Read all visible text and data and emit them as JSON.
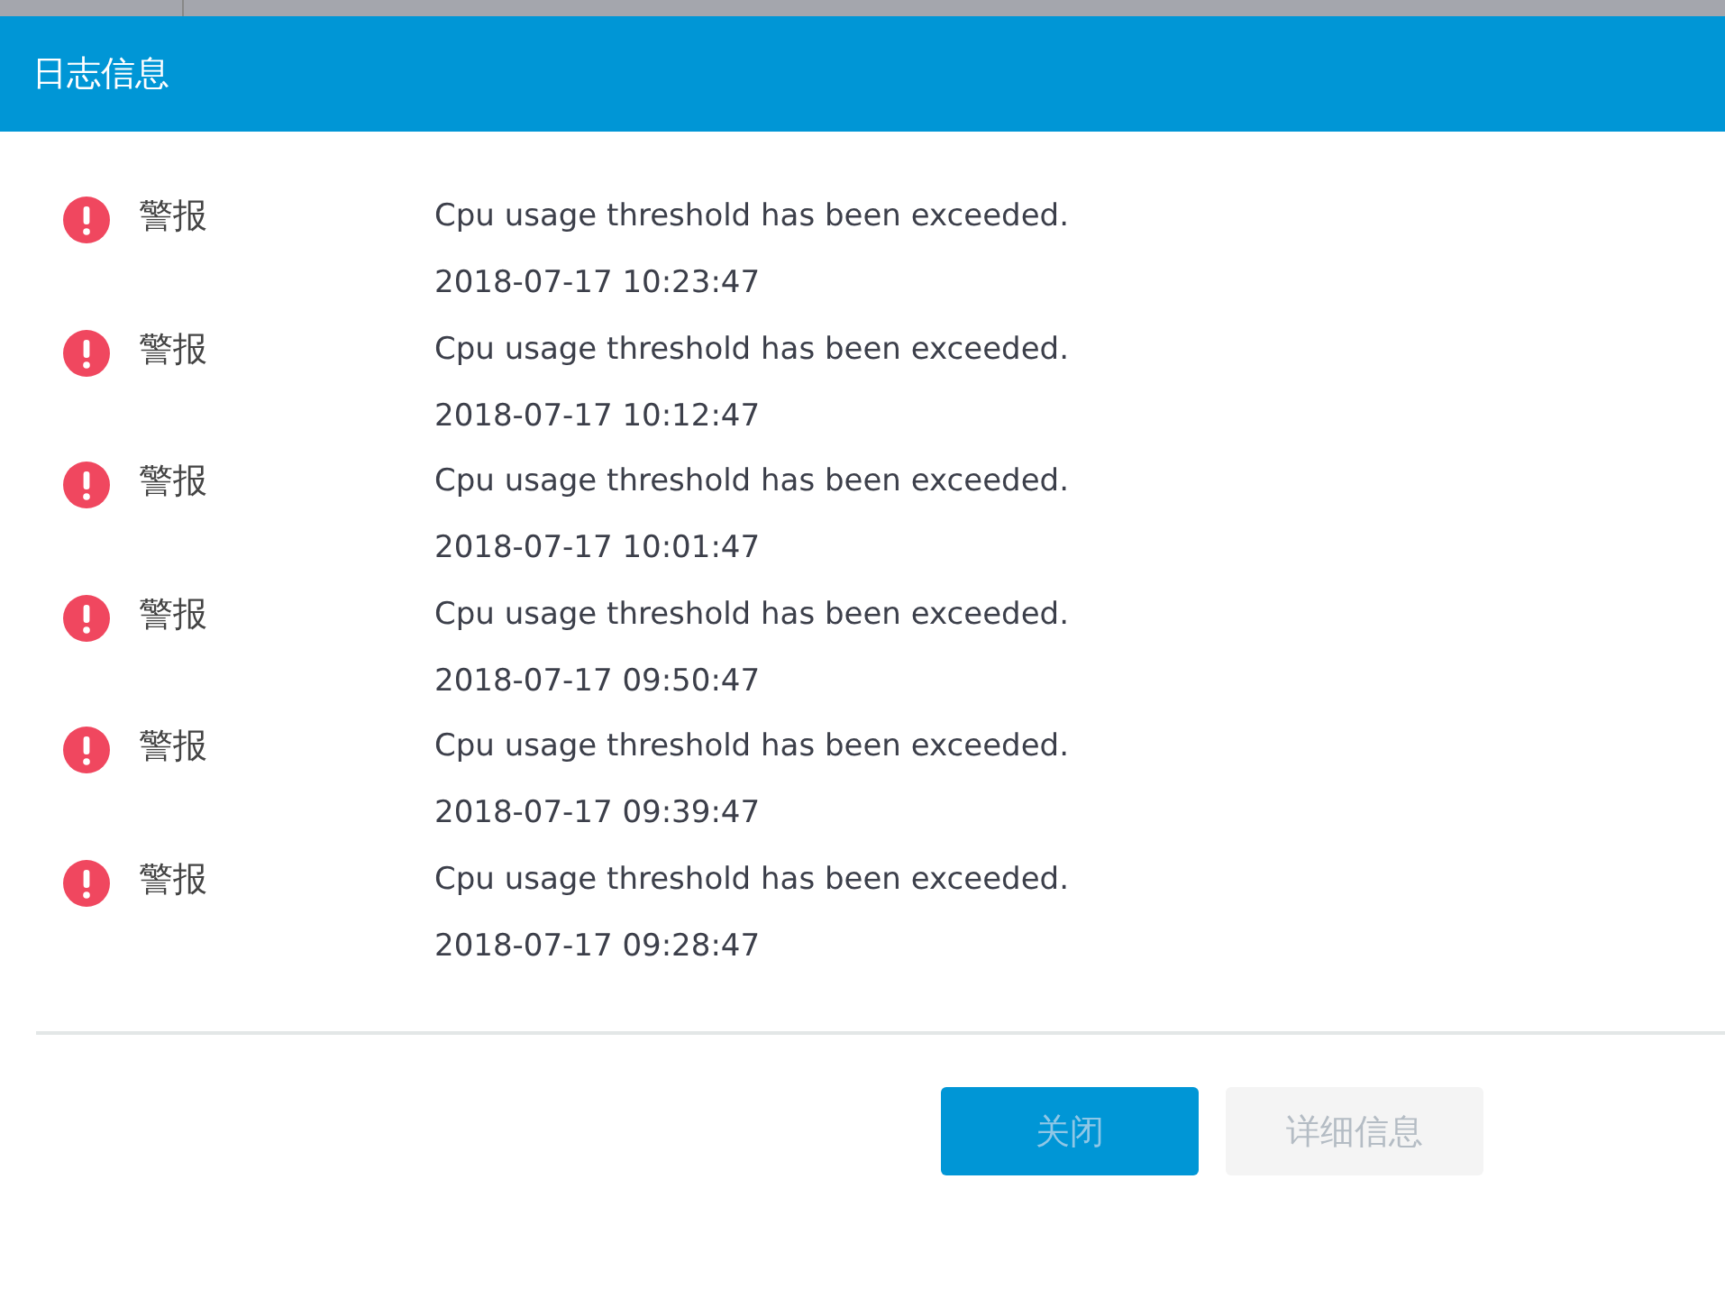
{
  "dialog": {
    "title": "日志信息"
  },
  "entries": [
    {
      "level": "警报",
      "message": "Cpu usage threshold has been exceeded.",
      "time": "2018-07-17 10:23:47"
    },
    {
      "level": "警报",
      "message": "Cpu usage threshold has been exceeded.",
      "time": "2018-07-17 10:12:47"
    },
    {
      "level": "警报",
      "message": "Cpu usage threshold has been exceeded.",
      "time": "2018-07-17 10:01:47"
    },
    {
      "level": "警报",
      "message": "Cpu usage threshold has been exceeded.",
      "time": "2018-07-17 09:50:47"
    },
    {
      "level": "警报",
      "message": "Cpu usage threshold has been exceeded.",
      "time": "2018-07-17 09:39:47"
    },
    {
      "level": "警报",
      "message": "Cpu usage threshold has been exceeded.",
      "time": "2018-07-17 09:28:47"
    }
  ],
  "buttons": [
    {
      "label": "关闭",
      "kind": "primary",
      "disabled": true
    },
    {
      "label": "详细信息",
      "kind": "default",
      "disabled": true
    }
  ]
}
